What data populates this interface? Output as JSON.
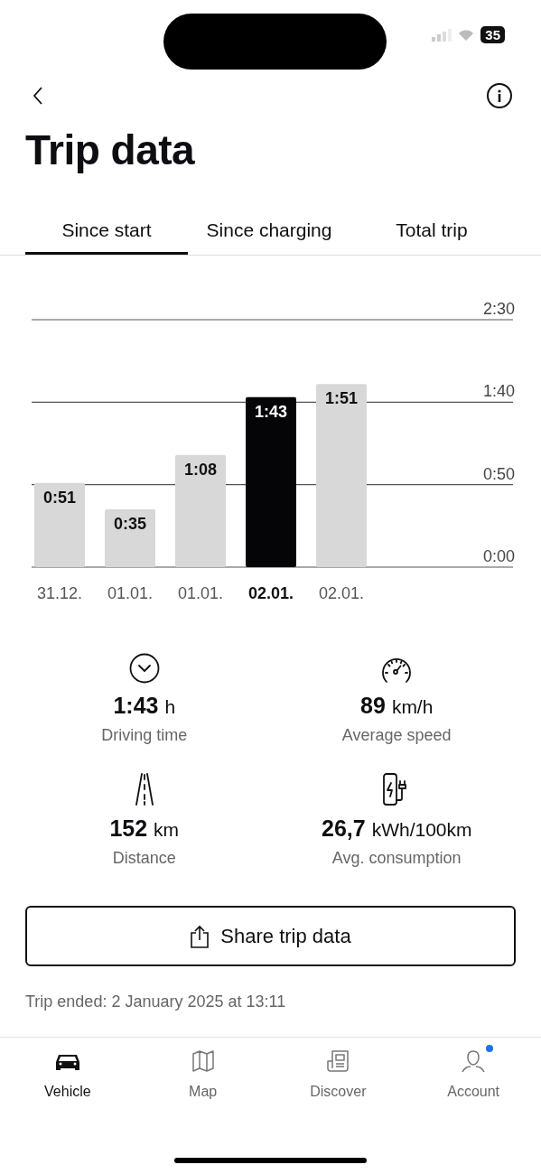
{
  "status_bar": {
    "battery": "35"
  },
  "header": {
    "title": "Trip data"
  },
  "tabs": [
    {
      "label": "Since start",
      "selected": true
    },
    {
      "label": "Since charging",
      "selected": false
    },
    {
      "label": "Total trip",
      "selected": false
    }
  ],
  "chart": {
    "chart_data": {
      "type": "bar",
      "categories": [
        "31.12.",
        "01.01.",
        "01.01.",
        "02.01.",
        "02.01."
      ],
      "values": [
        51,
        35,
        68,
        103,
        111
      ],
      "ylim": [
        0,
        150
      ],
      "yticks": [
        {
          "value": 0,
          "label": "0:00"
        },
        {
          "value": 50,
          "label": "0:50"
        },
        {
          "value": 100,
          "label": "1:40"
        },
        {
          "value": 150,
          "label": "2:30"
        }
      ],
      "data_labels": true,
      "value_labels": [
        "0:51",
        "0:35",
        "1:08",
        "1:43",
        "1:51"
      ]
    },
    "bars": [
      {
        "selected": false
      },
      {
        "selected": false
      },
      {
        "selected": false
      },
      {
        "selected": true
      },
      {
        "selected": false
      }
    ]
  },
  "stats": [
    {
      "kind": "time",
      "value": "1:43",
      "unit": "h",
      "label": "Driving time"
    },
    {
      "kind": "speed",
      "value": "89",
      "unit": "km/h",
      "label": "Average speed"
    },
    {
      "kind": "distance",
      "value": "152",
      "unit": "km",
      "label": "Distance"
    },
    {
      "kind": "consumption",
      "value": "26,7",
      "unit": "kWh/100km",
      "label": "Avg. consumption"
    }
  ],
  "share_button": {
    "label": "Share trip data"
  },
  "trip_ended": "Trip ended: 2 January 2025 at 13:11",
  "nav": [
    {
      "kind": "vehicle",
      "label": "Vehicle",
      "selected": true,
      "badge": false
    },
    {
      "kind": "map",
      "label": "Map",
      "selected": false,
      "badge": false
    },
    {
      "kind": "discover",
      "label": "Discover",
      "selected": false,
      "badge": false
    },
    {
      "kind": "account",
      "label": "Account",
      "selected": false,
      "badge": true
    }
  ]
}
